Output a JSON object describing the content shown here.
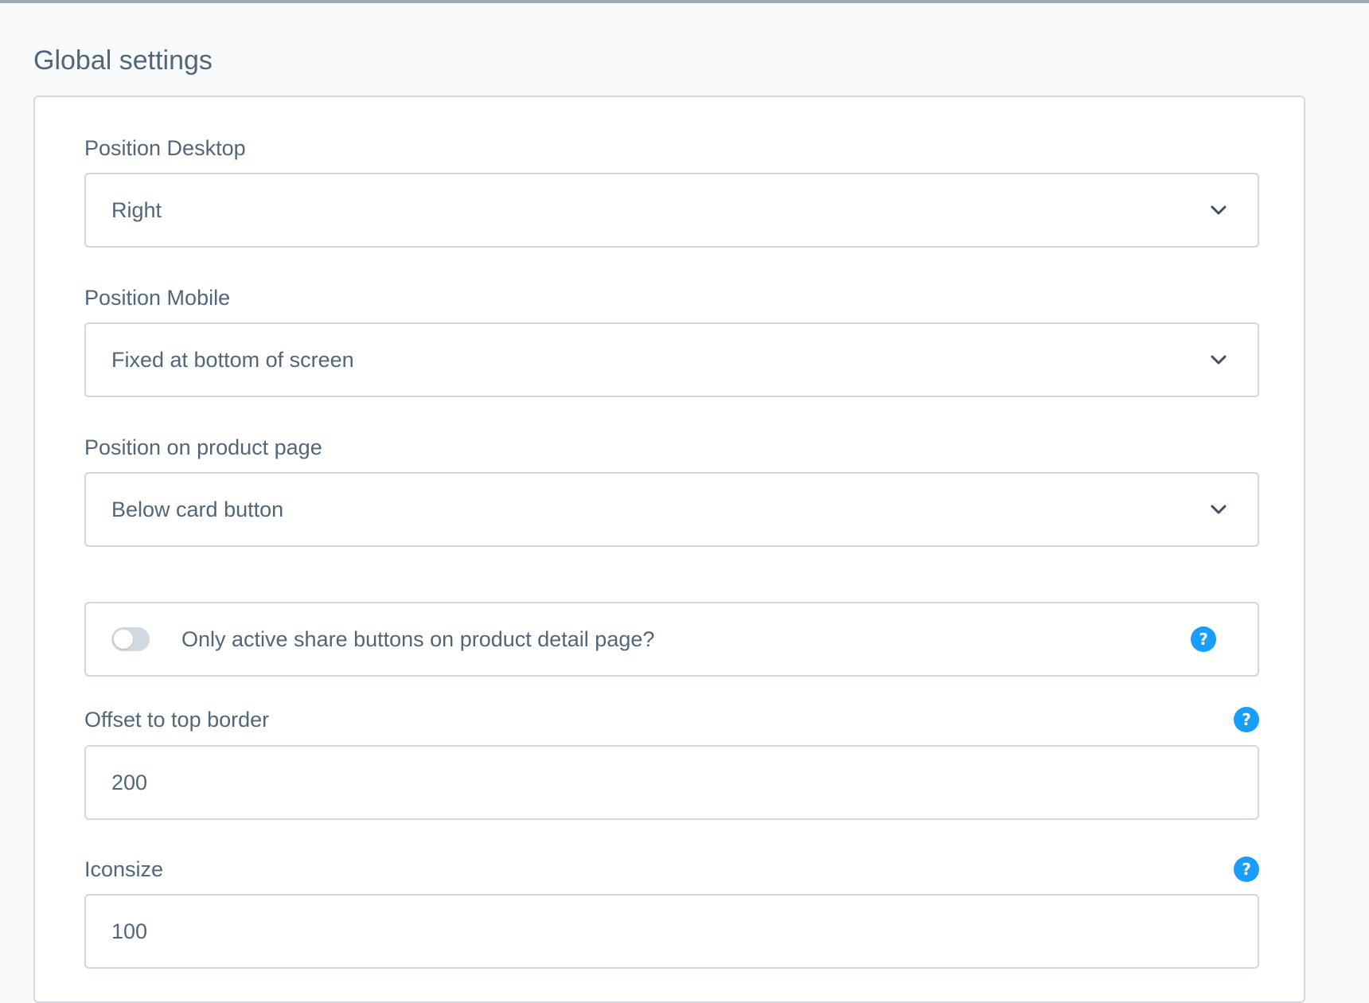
{
  "page": {
    "title": "Global settings"
  },
  "fields": {
    "position_desktop": {
      "label": "Position Desktop",
      "value": "Right",
      "icon": "chevron-down-icon"
    },
    "position_mobile": {
      "label": "Position Mobile",
      "value": "Fixed at bottom of screen",
      "icon": "chevron-down-icon"
    },
    "position_product_page": {
      "label": "Position on product page",
      "value": "Below card button",
      "icon": "chevron-down-icon"
    },
    "only_active_share": {
      "label": "Only active share buttons on product detail page?",
      "enabled": false,
      "help_icon": "?"
    },
    "offset_top": {
      "label": "Offset to top border",
      "value": "200",
      "help_icon": "?"
    },
    "iconsize": {
      "label": "Iconsize",
      "value": "100",
      "help_icon": "?"
    }
  },
  "colors": {
    "accent": "#189eff",
    "text": "#52667a",
    "border": "#d1d9e0",
    "background": "#f9fafb"
  }
}
